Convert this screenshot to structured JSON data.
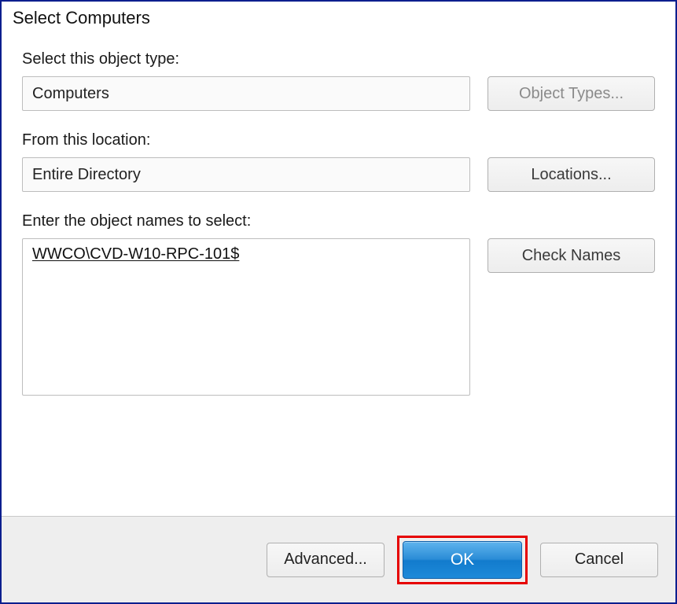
{
  "dialog": {
    "title": "Select Computers"
  },
  "objectType": {
    "label": "Select this object type:",
    "value": "Computers",
    "button": "Object Types..."
  },
  "location": {
    "label": "From this location:",
    "value": "Entire Directory",
    "button": "Locations..."
  },
  "objectNames": {
    "label": "Enter the object names to select:",
    "value": "WWCO\\CVD-W10-RPC-101$",
    "button": "Check Names"
  },
  "footer": {
    "advanced": "Advanced...",
    "ok": "OK",
    "cancel": "Cancel"
  }
}
